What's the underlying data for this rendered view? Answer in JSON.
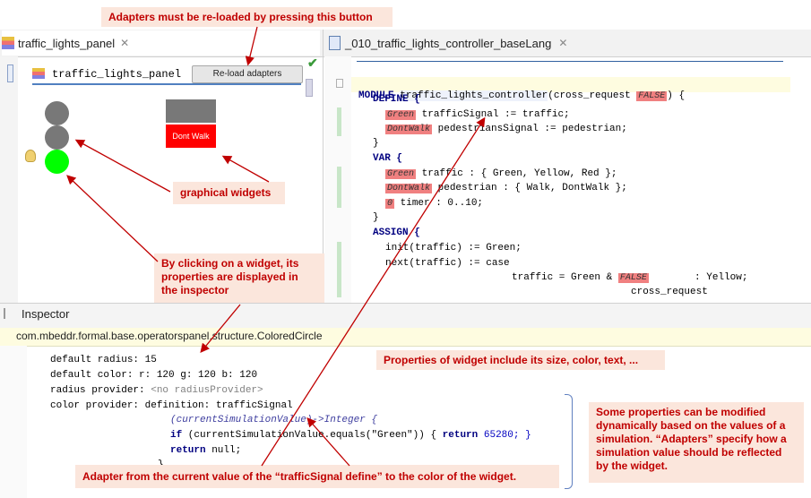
{
  "callouts": {
    "reload": "Adapters must be re-loaded by pressing this button",
    "graphical": "graphical widgets",
    "clicking": "By clicking on a widget, its properties are displayed in the inspector",
    "properties": "Properties of widget include its size, color, text, ...",
    "dynamic": "Some properties can be modified dynamically based on the values of a simulation. “Adapters” specify how a simulation value should be reflected by the widget.",
    "adapter": "Adapter from the current value of the “trafficSignal define” to the color of the widget."
  },
  "tabs": {
    "left": "traffic_lights_panel",
    "right": "_010_traffic_lights_controller_baseLang"
  },
  "panel": {
    "title": "traffic_lights_panel",
    "reload_button": "Re-load adapters",
    "dont_walk": "Dont Walk"
  },
  "code": {
    "module_kw": "MODULE",
    "module_name": "traffic_lights_controller",
    "module_param": "(cross_request",
    "false1": "FALSE",
    "module_end": ") {",
    "define_kw": "DEFINE {",
    "green_ref": "Green",
    "line_traffic_signal": " trafficSignal := traffic;",
    "dontwalk_ref": "DontWalk",
    "line_ped_signal": " pedestriansSignal := pedestrian;",
    "close1": "}",
    "var_kw": "VAR {",
    "green_ref2": "Green",
    "line_traffic_var": " traffic : { Green, Yellow, Red };",
    "dontwalk_ref2": "DontWalk",
    "line_ped_var": " pedestrian : { Walk, DontWalk };",
    "zero_ref": "0",
    "line_timer": " timer : 0..10;",
    "close2": "}",
    "assign_kw": "ASSIGN {",
    "init_line": "init(traffic) := Green;",
    "next_kw": "next",
    "next_line": "(traffic) := case",
    "case_line": "traffic = Green & ",
    "false2": "FALSE",
    "case_result": "  : Yellow;",
    "cross_line": "cross_request"
  },
  "inspector": {
    "title": "Inspector",
    "path": "com.mbeddr.formal.base.operatorspanel.structure.ColoredCircle",
    "radius_label": "default radius: ",
    "radius_value": "15",
    "color_label": "default color: ",
    "color_value": "r: 120 g: 120 b: 120",
    "radius_provider_label": "radius provider: ",
    "radius_provider_value": "<no radiusProvider>",
    "color_provider_label": "color provider: definition: ",
    "color_provider_value": "trafficSignal",
    "fn_line": "(currentSimulationValue)->Integer {",
    "if_kw": "if",
    "if_cond": " (currentSimulationValue.equals(\"Green\")) { ",
    "return_kw": "return",
    "return_val": " 65280; }",
    "return_null_kw": "return",
    "return_null": " null;",
    "close": "}"
  },
  "colors": {
    "green_light": "#00ff00",
    "grey_light": "#787878",
    "dont_walk_bg": "#ff0000",
    "callout_text": "#c00000",
    "callout_bg": "#fbe6dc"
  }
}
